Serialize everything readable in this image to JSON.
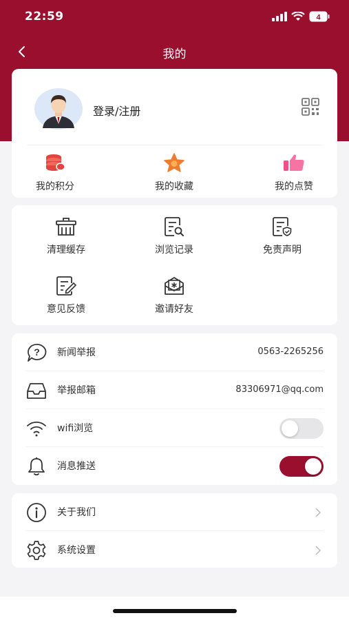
{
  "status": {
    "time": "22:59",
    "battery": "4"
  },
  "nav": {
    "title": "我的"
  },
  "profile": {
    "login_label": "登录/注册"
  },
  "stats": [
    {
      "label": "我的积分",
      "icon": "coins-icon"
    },
    {
      "label": "我的收藏",
      "icon": "star-icon"
    },
    {
      "label": "我的点赞",
      "icon": "thumbs-up-icon"
    }
  ],
  "tools": [
    {
      "label": "清理缓存",
      "icon": "trash-icon"
    },
    {
      "label": "浏览记录",
      "icon": "history-search-icon"
    },
    {
      "label": "免责声明",
      "icon": "disclaimer-icon"
    },
    {
      "label": "意见反馈",
      "icon": "feedback-edit-icon"
    },
    {
      "label": "邀请好友",
      "icon": "invite-envelope-icon"
    }
  ],
  "list": {
    "report": {
      "label": "新闻举报",
      "value": "0563-2265256",
      "icon": "question-bubble-icon"
    },
    "email": {
      "label": "举报邮箱",
      "value": "83306971@qq.com",
      "icon": "inbox-icon"
    },
    "wifi": {
      "label": "wifi浏览",
      "enabled": false,
      "icon": "wifi-icon"
    },
    "push": {
      "label": "消息推送",
      "enabled": true,
      "icon": "bell-icon"
    }
  },
  "settings": {
    "about": {
      "label": "关于我们",
      "icon": "info-icon"
    },
    "system": {
      "label": "系统设置",
      "icon": "gear-icon"
    }
  },
  "colors": {
    "brand": "#9b0f2e",
    "coins": "#e2453f",
    "star": "#f07b2e",
    "thumb": "#f24f8a"
  }
}
